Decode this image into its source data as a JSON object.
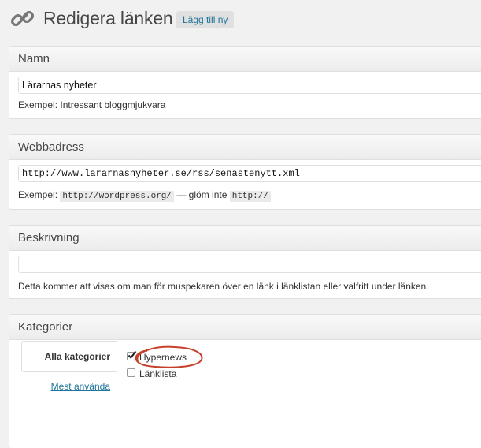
{
  "header": {
    "title": "Redigera länken",
    "add_new_label": "Lägg till ny",
    "icon": "link-icon"
  },
  "name_box": {
    "title": "Namn",
    "value": "Lärarnas nyheter",
    "hint": "Exempel: Intressant bloggmjukvara"
  },
  "url_box": {
    "title": "Webbadress",
    "value": "http://www.lararnasnyheter.se/rss/senastenytt.xml",
    "hint_prefix": "Exempel:",
    "hint_code1": "http://wordpress.org/",
    "hint_middle": "— glöm inte",
    "hint_code2": "http://"
  },
  "description_box": {
    "title": "Beskrivning",
    "value": "",
    "hint": "Detta kommer att visas om man för muspekaren över en länk i länklistan eller valfritt under länken."
  },
  "categories_box": {
    "title": "Kategorier",
    "tab_all": "Alla kategorier",
    "tab_popular": "Mest använda",
    "items": [
      {
        "label": "Hypernews",
        "checked": true
      },
      {
        "label": "Länklista",
        "checked": false
      }
    ],
    "annotation_color": "#c8402a"
  },
  "colors": {
    "link": "#21759b",
    "background": "#f1f1f1"
  }
}
